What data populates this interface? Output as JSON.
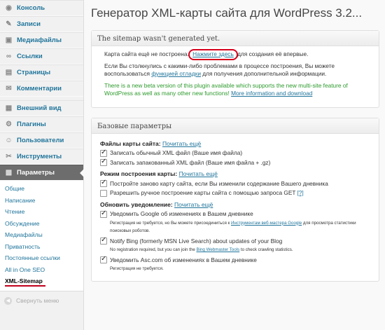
{
  "sidebar": {
    "items": [
      {
        "label": "Консоль",
        "icon": "dashboard-icon",
        "glyph": "◉"
      },
      {
        "label": "Записи",
        "icon": "pin-icon",
        "glyph": "✎"
      },
      {
        "label": "Медиафайлы",
        "icon": "media-icon",
        "glyph": "▣"
      },
      {
        "label": "Ссылки",
        "icon": "link-icon",
        "glyph": "∞"
      },
      {
        "label": "Страницы",
        "icon": "pages-icon",
        "glyph": "▤"
      },
      {
        "label": "Комментарии",
        "icon": "comments-icon",
        "glyph": "✉"
      },
      {
        "label": "Внешний вид",
        "icon": "appearance-icon",
        "glyph": "▦"
      },
      {
        "label": "Плагины",
        "icon": "plugins-icon",
        "glyph": "⚙"
      },
      {
        "label": "Пользователи",
        "icon": "users-icon",
        "glyph": "☺"
      },
      {
        "label": "Инструменты",
        "icon": "tools-icon",
        "glyph": "✂"
      },
      {
        "label": "Параметры",
        "icon": "settings-icon",
        "glyph": "▩"
      }
    ],
    "submenu": [
      "Общие",
      "Написание",
      "Чтение",
      "Обсуждение",
      "Медиафайлы",
      "Приватность",
      "Постоянные ссылки",
      "All in One SEO",
      "XML-Sitemap"
    ],
    "collapse_label": "Свернуть меню"
  },
  "main": {
    "title": "Генератор XML-карты сайта для WordPress 3.2...",
    "notice": {
      "heading": "The sitemap wasn't generated yet.",
      "line1_pre": "Карта сайта ещё не построена. ",
      "line1_link": "Нажмите здесь",
      "line1_post": " для создания её впервые.",
      "line2_pre": "Если Вы столкнулись с какими-либо проблемами в процессе построения, Вы можете воспользоваться ",
      "line2_link": "функцией отладки",
      "line2_post": " для получения дополнительной информации.",
      "beta_text": "There is a new beta version of this plugin available which supports the new multi-site feature of WordPress as well as many other new functions! ",
      "beta_link": "More information and download"
    },
    "basic": {
      "heading": "Базовые параметры",
      "files_label": "Файлы карты сайта:",
      "files_link": "Почитать ещё",
      "opt_xml": "Записать обычный XML файл (Ваше имя файла)",
      "opt_gz": "Записать запакованный XML файл (Ваше имя файла + .gz)",
      "mode_label": "Режим построения карты:",
      "mode_link": "Почитать ещё",
      "opt_rebuild": "Постройте заново карту сайта, если Вы изменили содержание Вашего дневника",
      "opt_manual": "Разрешить ручное построение карты сайта с помощью запроса GET",
      "opt_manual_help": "[?]",
      "notify_label": "Обновить уведомление:",
      "notify_link": "Почитать ещё",
      "opt_google": "Уведомить Google об изменениях в Вашем дневнике",
      "google_note_pre": "Регистрация не требуется, но Вы можете присоединиться к ",
      "google_note_link": "Инструментам веб-мастера Google",
      "google_note_post": " для просмотра статистики поисковых роботов.",
      "opt_bing": "Notify Bing (formerly MSN Live Search) about updates of your Blog",
      "bing_note_pre": "No registration required, but you can join the ",
      "bing_note_link": "Bing Webmaster Tools",
      "bing_note_post": " to check crawling statistics.",
      "opt_asc": "Уведомить Asc.com об изменениях в Вашем дневнике",
      "asc_note": "Регистрация не требуется."
    }
  }
}
